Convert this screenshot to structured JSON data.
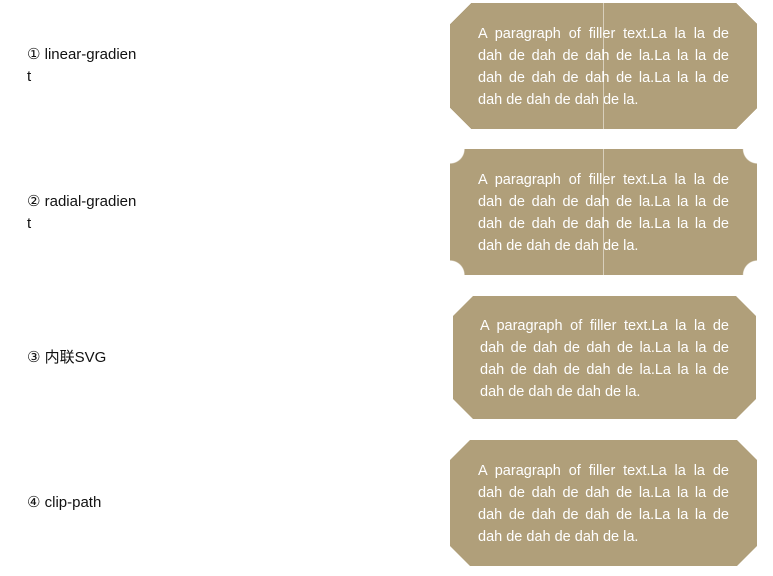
{
  "theme": {
    "card_color": "#b09f7a",
    "text_color": "#ffffff",
    "label_color": "#111111"
  },
  "rows": [
    {
      "label": "① linear-gradient",
      "text": "A paragraph of filler text.La la la de dah de dah de dah de la.La la la de dah de dah de dah de la.La la la de dah de dah de dah de la."
    },
    {
      "label": "② radial-gradient",
      "text": "A paragraph of filler text.La la la de dah de dah de dah de la.La la la de dah de dah de dah de la.La la la de dah de dah de dah de la."
    },
    {
      "label": "③ 内联SVG",
      "text": "A paragraph of filler text.La la la de dah de dah de dah de la.La la la de dah de dah de dah de la.La la la de dah de dah de dah de la."
    },
    {
      "label": "④ clip-path",
      "text": "A paragraph of filler text.La la la de dah de dah de dah de la.La la la de dah de dah de dah de la.La la la de dah de dah de dah de la."
    }
  ]
}
